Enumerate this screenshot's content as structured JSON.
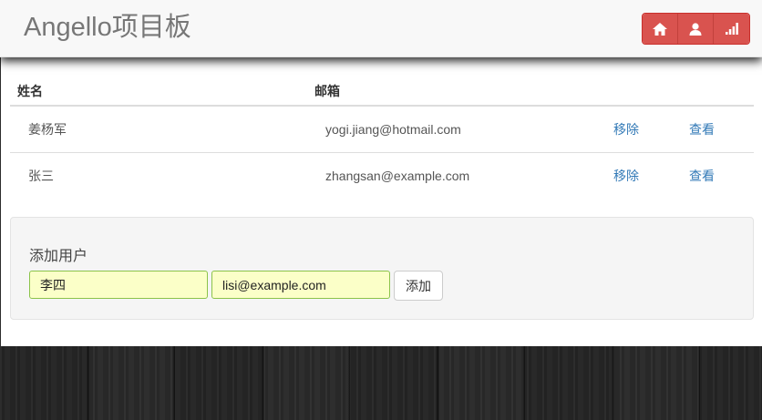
{
  "header": {
    "brand": "Angello项目板",
    "nav_buttons": [
      {
        "icon": "home-icon"
      },
      {
        "icon": "user-icon"
      },
      {
        "icon": "signal-icon"
      }
    ],
    "accent_color": "#d9534f"
  },
  "users_table": {
    "columns": [
      "姓名",
      "邮箱"
    ],
    "rows": [
      {
        "name": "姜杨军",
        "email": "yogi.jiang@hotmail.com",
        "remove": "移除",
        "view": "查看"
      },
      {
        "name": "张三",
        "email": "zhangsan@example.com",
        "remove": "移除",
        "view": "查看"
      }
    ]
  },
  "add_user": {
    "title": "添加用户",
    "name_value": "李四",
    "email_value": "lisi@example.com",
    "submit_label": "添加"
  }
}
